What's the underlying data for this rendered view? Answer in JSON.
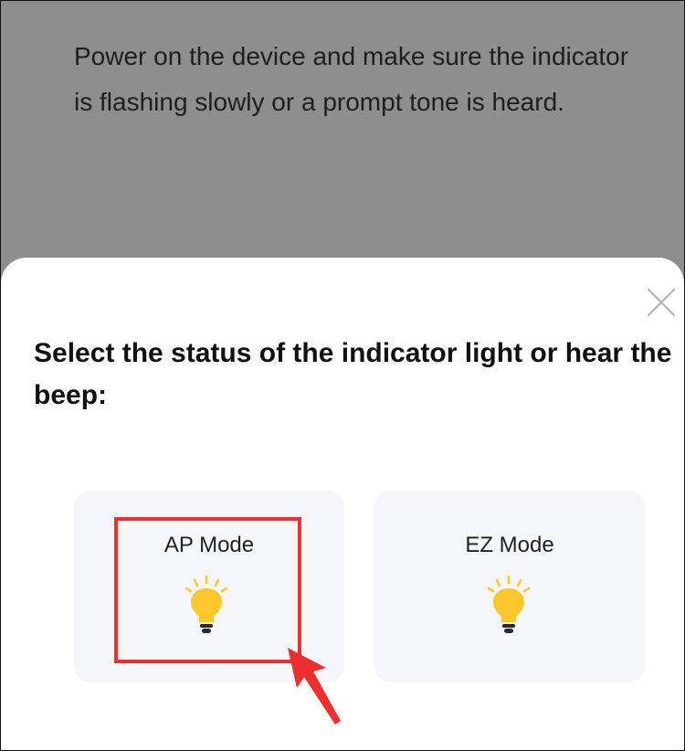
{
  "background_screen": {
    "instruction": "Power on the device and make sure the indicator is flashing slowly or a prompt tone is heard."
  },
  "sheet": {
    "close_icon": "close-icon",
    "title": "Select the status of the indicator light or hear the beep:",
    "modes": [
      {
        "label": "AP Mode",
        "icon": "light-bulb-icon"
      },
      {
        "label": "EZ Mode",
        "icon": "light-bulb-icon"
      }
    ]
  },
  "annotation": {
    "highlight_color": "#ee2f2f"
  },
  "colors": {
    "backdrop": "#8e8e8e",
    "sheet": "#ffffff",
    "card": "#f5f6fa",
    "bulb": "#ffc62e",
    "bulb_base": "#2b2b2b"
  }
}
